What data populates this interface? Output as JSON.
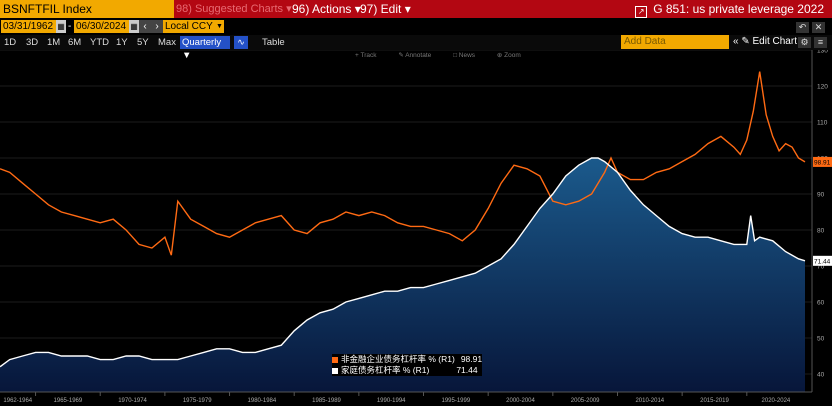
{
  "toolbar": {
    "ticker": "BSNFTFIL Index",
    "suggested": "98) Suggested Charts ▾",
    "actions": "96) Actions ▾",
    "edit": "97) Edit ▾",
    "title": "G 851: us private leverage 2022",
    "title_icon": "export-icon"
  },
  "controls": {
    "start_date": "03/31/1962",
    "end_date": "06/30/2024",
    "dash": "-",
    "currency": "Local CCY"
  },
  "ranges": [
    "1D",
    "3D",
    "1M",
    "6M",
    "YTD",
    "1Y",
    "5Y",
    "Max"
  ],
  "frequency": "Quarterly ▼",
  "table_label": "Table",
  "add_data_placeholder": "Add Data",
  "edit_chart": "Edit Chart",
  "chart_tools": [
    "Track",
    "Annotate",
    "News",
    "Zoom"
  ],
  "colors": {
    "accent": "#f2a900",
    "brand_bar": "#b30712",
    "series_orange": "#ff6a13",
    "series_white": "#ffffff",
    "area_fill_top": "#1b5a8c",
    "area_fill_bottom": "#07163a"
  },
  "chart_data": {
    "type": "line",
    "title": "",
    "xlabel": "",
    "ylabel": "",
    "ylim": [
      35,
      130
    ],
    "y_ticks": [
      40,
      50,
      60,
      70,
      80,
      90,
      100,
      110,
      120,
      130
    ],
    "x_tick_labels": [
      "1962-1964",
      "1965-1969",
      "1970-1974",
      "1975-1979",
      "1980-1984",
      "1985-1989",
      "1990-1994",
      "1995-1999",
      "2000-2004",
      "2005-2009",
      "2010-2014",
      "2015-2019",
      "2020-2024"
    ],
    "series": [
      {
        "name": "非金融企业债务杠杆率 % (R1)",
        "last_value": 98.91,
        "last_label": "98.91",
        "color": "#ff6a13",
        "points": [
          [
            1962.25,
            97
          ],
          [
            1963,
            96
          ],
          [
            1964,
            93
          ],
          [
            1965,
            90
          ],
          [
            1966,
            87
          ],
          [
            1967,
            85
          ],
          [
            1968,
            84
          ],
          [
            1969,
            83
          ],
          [
            1970,
            82
          ],
          [
            1971,
            83
          ],
          [
            1972,
            80
          ],
          [
            1973,
            76
          ],
          [
            1974,
            75
          ],
          [
            1975,
            78
          ],
          [
            1975.5,
            73
          ],
          [
            1976,
            88
          ],
          [
            1977,
            83
          ],
          [
            1978,
            81
          ],
          [
            1979,
            79
          ],
          [
            1980,
            78
          ],
          [
            1981,
            80
          ],
          [
            1982,
            82
          ],
          [
            1983,
            83
          ],
          [
            1984,
            84
          ],
          [
            1985,
            80
          ],
          [
            1986,
            79
          ],
          [
            1987,
            82
          ],
          [
            1988,
            83
          ],
          [
            1989,
            85
          ],
          [
            1990,
            84
          ],
          [
            1991,
            85
          ],
          [
            1992,
            84
          ],
          [
            1993,
            82
          ],
          [
            1994,
            81
          ],
          [
            1995,
            81
          ],
          [
            1996,
            80
          ],
          [
            1997,
            79
          ],
          [
            1998,
            77
          ],
          [
            1999,
            80
          ],
          [
            2000,
            86
          ],
          [
            2001,
            93
          ],
          [
            2002,
            98
          ],
          [
            2003,
            97
          ],
          [
            2004,
            95
          ],
          [
            2005,
            88
          ],
          [
            2006,
            87
          ],
          [
            2007,
            88
          ],
          [
            2008,
            90
          ],
          [
            2009,
            96
          ],
          [
            2009.5,
            100
          ],
          [
            2010,
            96
          ],
          [
            2011,
            94
          ],
          [
            2012,
            94
          ],
          [
            2013,
            96
          ],
          [
            2014,
            97
          ],
          [
            2015,
            99
          ],
          [
            2016,
            101
          ],
          [
            2017,
            104
          ],
          [
            2018,
            106
          ],
          [
            2019,
            103
          ],
          [
            2019.5,
            101
          ],
          [
            2020,
            105
          ],
          [
            2020.5,
            113
          ],
          [
            2021,
            124
          ],
          [
            2021.5,
            112
          ],
          [
            2022,
            106
          ],
          [
            2022.5,
            102
          ],
          [
            2023,
            104
          ],
          [
            2023.5,
            103
          ],
          [
            2024,
            100
          ],
          [
            2024.5,
            98.91
          ]
        ]
      },
      {
        "name": "家庭债务杠杆率 % (R1)",
        "last_value": 71.44,
        "last_label": "71.44",
        "color": "#ffffff",
        "points": [
          [
            1962.25,
            42
          ],
          [
            1963,
            44
          ],
          [
            1964,
            45
          ],
          [
            1965,
            46
          ],
          [
            1966,
            46
          ],
          [
            1967,
            45
          ],
          [
            1968,
            45
          ],
          [
            1969,
            45
          ],
          [
            1970,
            44
          ],
          [
            1971,
            44
          ],
          [
            1972,
            45
          ],
          [
            1973,
            45
          ],
          [
            1974,
            44
          ],
          [
            1975,
            44
          ],
          [
            1976,
            44
          ],
          [
            1977,
            45
          ],
          [
            1978,
            46
          ],
          [
            1979,
            47
          ],
          [
            1980,
            47
          ],
          [
            1981,
            46
          ],
          [
            1982,
            46
          ],
          [
            1983,
            47
          ],
          [
            1984,
            48
          ],
          [
            1985,
            52
          ],
          [
            1986,
            55
          ],
          [
            1987,
            57
          ],
          [
            1988,
            58
          ],
          [
            1989,
            60
          ],
          [
            1990,
            61
          ],
          [
            1991,
            62
          ],
          [
            1992,
            63
          ],
          [
            1993,
            63
          ],
          [
            1994,
            64
          ],
          [
            1995,
            64
          ],
          [
            1996,
            65
          ],
          [
            1997,
            66
          ],
          [
            1998,
            67
          ],
          [
            1999,
            68
          ],
          [
            2000,
            70
          ],
          [
            2001,
            72
          ],
          [
            2002,
            76
          ],
          [
            2003,
            81
          ],
          [
            2004,
            86
          ],
          [
            2005,
            90
          ],
          [
            2006,
            95
          ],
          [
            2007,
            98
          ],
          [
            2008,
            100
          ],
          [
            2008.5,
            100
          ],
          [
            2009,
            99
          ],
          [
            2010,
            96
          ],
          [
            2011,
            91
          ],
          [
            2012,
            87
          ],
          [
            2013,
            84
          ],
          [
            2014,
            81
          ],
          [
            2015,
            79
          ],
          [
            2016,
            78
          ],
          [
            2017,
            78
          ],
          [
            2018,
            77
          ],
          [
            2019,
            76
          ],
          [
            2020,
            76
          ],
          [
            2020.3,
            84
          ],
          [
            2020.6,
            77
          ],
          [
            2021,
            78
          ],
          [
            2022,
            77
          ],
          [
            2023,
            74
          ],
          [
            2024,
            72
          ],
          [
            2024.5,
            71.44
          ]
        ]
      }
    ]
  }
}
